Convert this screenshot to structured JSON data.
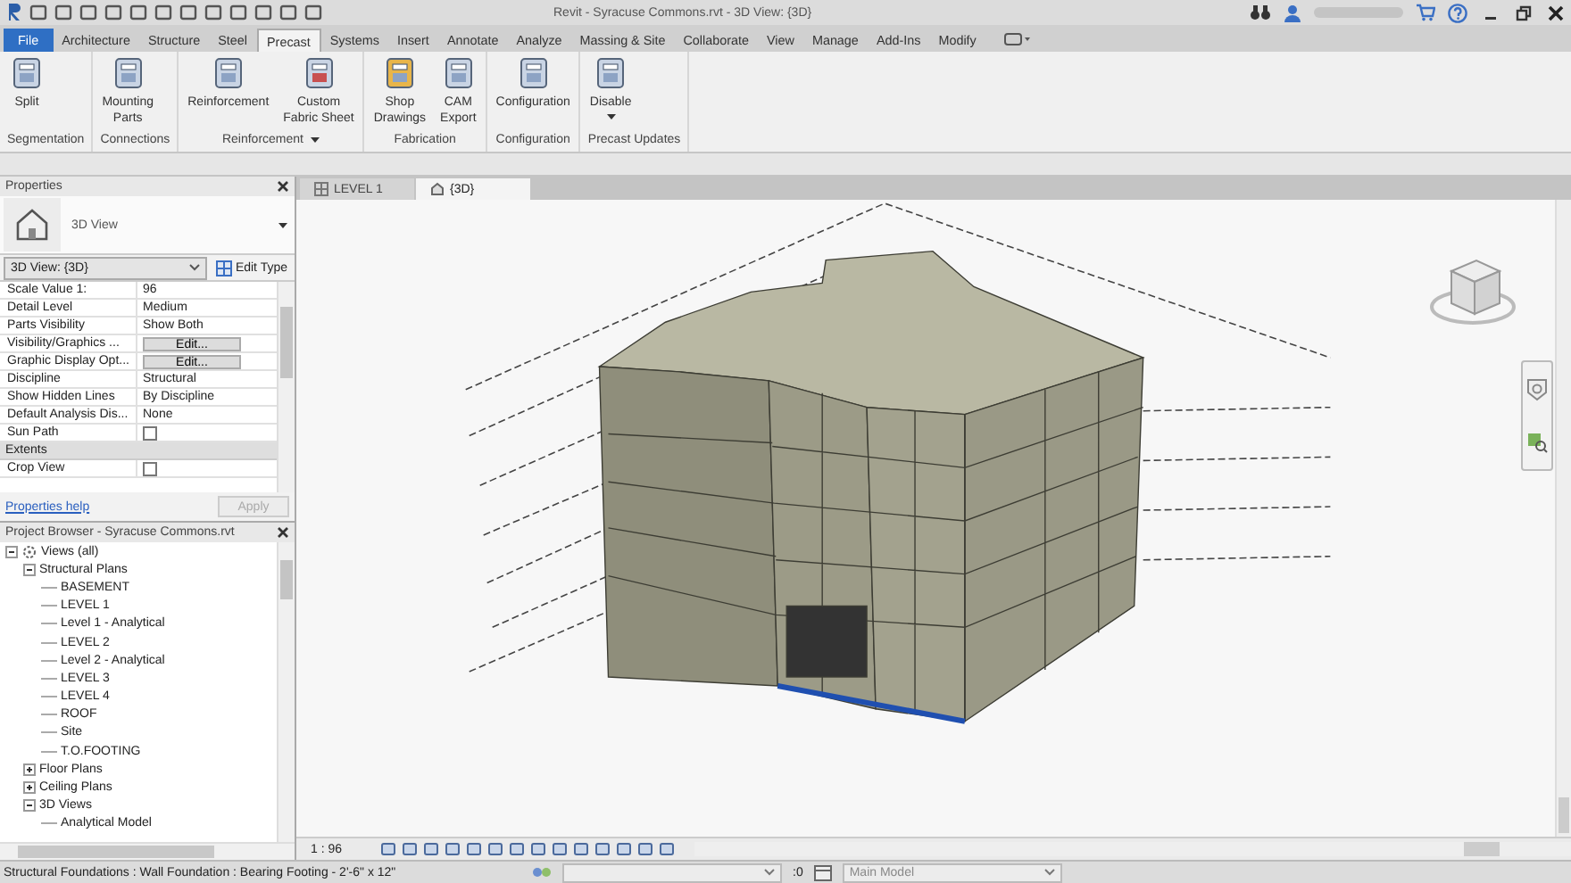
{
  "title_bar": {
    "title": "Revit - Syracuse Commons.rvt - 3D View: {3D}"
  },
  "ribbon_tabs": [
    {
      "label": "File",
      "kind": "file",
      "selected": false
    },
    {
      "label": "Architecture",
      "kind": "tab",
      "selected": false
    },
    {
      "label": "Structure",
      "kind": "tab",
      "selected": false
    },
    {
      "label": "Steel",
      "kind": "tab",
      "selected": false
    },
    {
      "label": "Precast",
      "kind": "tab",
      "selected": true
    },
    {
      "label": "Systems",
      "kind": "tab",
      "selected": false
    },
    {
      "label": "Insert",
      "kind": "tab",
      "selected": false
    },
    {
      "label": "Annotate",
      "kind": "tab",
      "selected": false
    },
    {
      "label": "Analyze",
      "kind": "tab",
      "selected": false
    },
    {
      "label": "Massing & Site",
      "kind": "tab",
      "selected": false
    },
    {
      "label": "Collaborate",
      "kind": "tab",
      "selected": false
    },
    {
      "label": "View",
      "kind": "tab",
      "selected": false
    },
    {
      "label": "Manage",
      "kind": "tab",
      "selected": false
    },
    {
      "label": "Add-Ins",
      "kind": "tab",
      "selected": false
    },
    {
      "label": "Modify",
      "kind": "tab",
      "selected": false
    }
  ],
  "ribbon_panels": [
    {
      "label": "Segmentation",
      "tools": [
        {
          "lines": [
            "Split"
          ]
        }
      ]
    },
    {
      "label": "Connections",
      "tools": [
        {
          "lines": [
            "Mounting",
            "Parts"
          ]
        }
      ]
    },
    {
      "label": "Reinforcement",
      "dropdown": true,
      "tools": [
        {
          "lines": [
            "Reinforcement"
          ]
        },
        {
          "lines": [
            "Custom",
            "Fabric Sheet"
          ]
        }
      ]
    },
    {
      "label": "Fabrication",
      "tools": [
        {
          "lines": [
            "Shop",
            "Drawings"
          ]
        },
        {
          "lines": [
            "CAM",
            "Export"
          ]
        }
      ]
    },
    {
      "label": "Configuration",
      "tools": [
        {
          "lines": [
            "Configuration"
          ]
        }
      ]
    },
    {
      "label": "Precast Updates",
      "tools": [
        {
          "lines": [
            "Disable"
          ],
          "dropdown": true
        }
      ]
    }
  ],
  "properties": {
    "title": "Properties",
    "type_name": "3D View",
    "selector": "3D View: {3D}",
    "edit_type": "Edit Type",
    "rows": [
      {
        "kind": "text",
        "label": "Scale Value    1:",
        "value": "96"
      },
      {
        "kind": "text",
        "label": "Detail Level",
        "value": "Medium"
      },
      {
        "kind": "text",
        "label": "Parts Visibility",
        "value": "Show Both"
      },
      {
        "kind": "button",
        "label": "Visibility/Graphics ...",
        "value": "Edit..."
      },
      {
        "kind": "button",
        "label": "Graphic Display Opt...",
        "value": "Edit..."
      },
      {
        "kind": "text",
        "label": "Discipline",
        "value": "Structural"
      },
      {
        "kind": "text",
        "label": "Show Hidden Lines",
        "value": "By Discipline"
      },
      {
        "kind": "text",
        "label": "Default Analysis Dis...",
        "value": "None"
      },
      {
        "kind": "checkbox",
        "label": "Sun Path",
        "checked": false
      },
      {
        "kind": "group",
        "label": "Extents"
      },
      {
        "kind": "checkbox",
        "label": "Crop View",
        "checked": false
      }
    ],
    "help_link": "Properties help",
    "apply": {
      "label": "Apply",
      "disabled": true
    }
  },
  "project_browser": {
    "title": "Project Browser - Syracuse Commons.rvt",
    "tree": [
      {
        "label": "Views (all)",
        "expanded": true,
        "children": [
          {
            "label": "Structural Plans",
            "expanded": true,
            "children": [
              {
                "label": "BASEMENT"
              },
              {
                "label": "LEVEL 1"
              },
              {
                "label": "Level 1 - Analytical"
              },
              {
                "label": "LEVEL 2"
              },
              {
                "label": "Level 2 - Analytical"
              },
              {
                "label": "LEVEL 3"
              },
              {
                "label": "LEVEL 4"
              },
              {
                "label": "ROOF"
              },
              {
                "label": "Site"
              },
              {
                "label": "T.O.FOOTING"
              }
            ]
          },
          {
            "label": "Floor Plans",
            "expanded": false
          },
          {
            "label": "Ceiling Plans",
            "expanded": false
          },
          {
            "label": "3D Views",
            "expanded": true,
            "children": [
              {
                "label": "Analytical Model"
              }
            ]
          }
        ]
      }
    ]
  },
  "view_tabs": [
    {
      "label": "LEVEL 1",
      "selected": false
    },
    {
      "label": "{3D}",
      "selected": true
    }
  ],
  "view_control_bar": {
    "scale": "1 : 96"
  },
  "status_bar": {
    "message": "Structural Foundations : Wall Foundation : Bearing Footing - 2'-6\" x 12\"",
    "counter": ":0",
    "model": "Main Model"
  }
}
